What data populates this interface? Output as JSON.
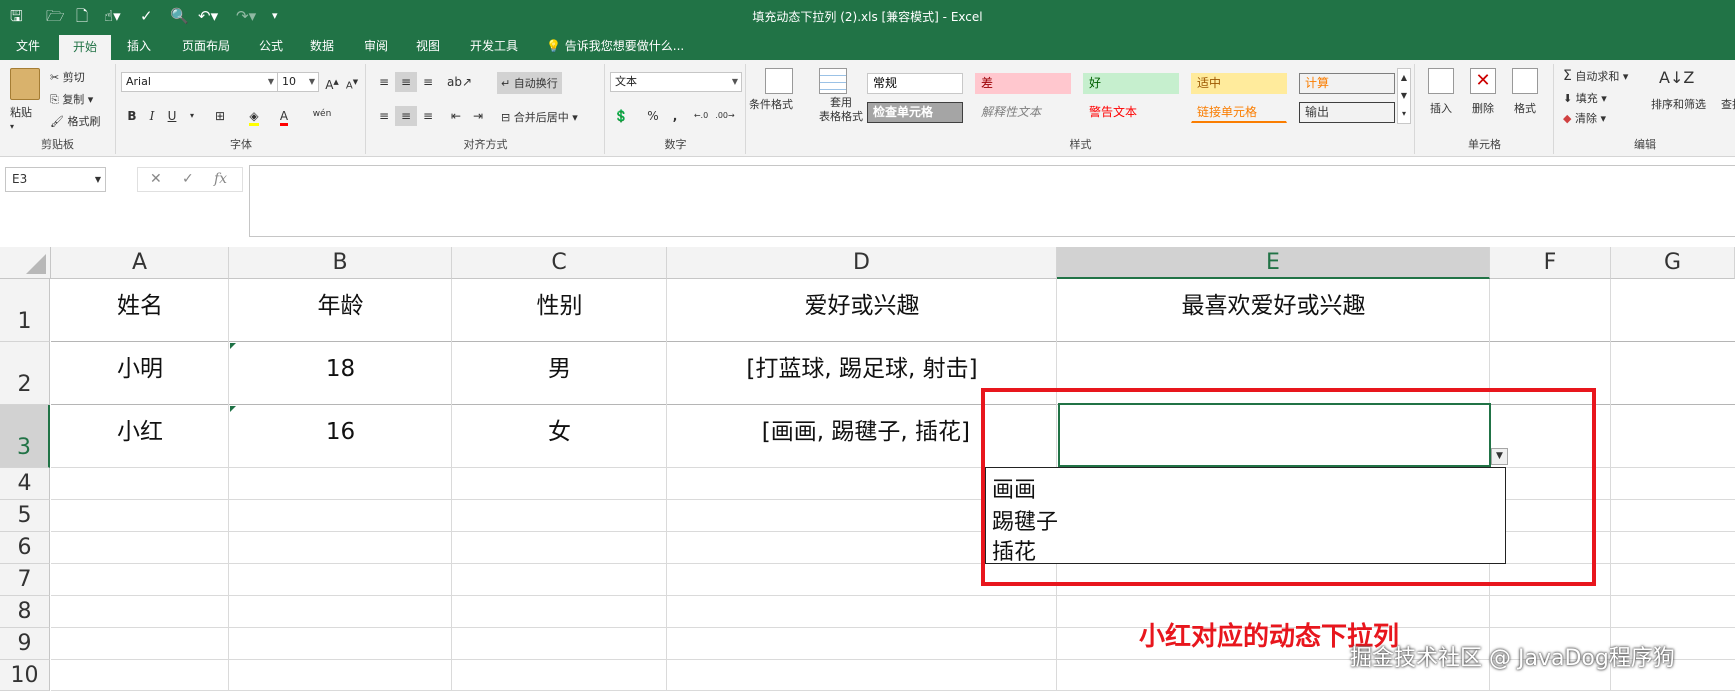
{
  "window": {
    "title": "填充动态下拉列 (2).xls  [兼容模式] - Excel",
    "accent_color": "#217346"
  },
  "quick_access": {
    "icons": [
      "save-icon",
      "open-icon",
      "new-icon",
      "touch-mode-icon",
      "spellcheck-icon",
      "print-preview-icon",
      "undo-icon",
      "redo-icon",
      "customize-icon"
    ]
  },
  "tabs": [
    "文件",
    "开始",
    "插入",
    "页面布局",
    "公式",
    "数据",
    "审阅",
    "视图",
    "开发工具"
  ],
  "active_tab": "开始",
  "tell_me": "告诉我您想要做什么...",
  "ribbon": {
    "clipboard": {
      "label": "剪贴板",
      "paste": "粘贴",
      "cut": "剪切",
      "copy": "复制",
      "format_painter": "格式刷"
    },
    "font": {
      "label": "字体",
      "name": "Arial",
      "size": "10",
      "bold": "B",
      "italic": "I",
      "underline": "U",
      "phonetic": "wén"
    },
    "alignment": {
      "label": "对齐方式",
      "wrap": "自动换行",
      "merge": "合并后居中"
    },
    "number": {
      "label": "数字",
      "format": "文本",
      "percent": "%",
      "comma": ","
    },
    "styles": {
      "label": "样式",
      "conditional": "条件格式",
      "table": "套用\n表格格式",
      "items": [
        {
          "text": "常规",
          "bg": "#ffffff",
          "fg": "#000000",
          "border": "#c8c8c8"
        },
        {
          "text": "差",
          "bg": "#ffc7ce",
          "fg": "#9c0006",
          "border": "#ffc7ce"
        },
        {
          "text": "好",
          "bg": "#c6efce",
          "fg": "#006100",
          "border": "#c6efce"
        },
        {
          "text": "适中",
          "bg": "#ffeb9c",
          "fg": "#9c5700",
          "border": "#ffeb9c"
        },
        {
          "text": "计算",
          "bg": "#f2f2f2",
          "fg": "#fa7d00",
          "border": "#7f7f7f"
        },
        {
          "text": "检查单元格",
          "bg": "#a5a5a5",
          "fg": "#ffffff",
          "border": "#3f3f3f"
        },
        {
          "text": "解释性文本",
          "bg": "#f3f3f3",
          "fg": "#7f7f7f",
          "border": "#f3f3f3"
        },
        {
          "text": "警告文本",
          "bg": "#f3f3f3",
          "fg": "#ff0000",
          "border": "#f3f3f3"
        },
        {
          "text": "链接单元格",
          "bg": "#f3f3f3",
          "fg": "#fa7d00",
          "border": "#f3f3f3"
        },
        {
          "text": "输出",
          "bg": "#f2f2f2",
          "fg": "#3f3f3f",
          "border": "#3f3f3f"
        }
      ]
    },
    "cells": {
      "label": "单元格",
      "insert": "插入",
      "delete": "删除",
      "format": "格式"
    },
    "editing": {
      "label": "编辑",
      "autosum": "自动求和",
      "fill": "填充",
      "clear": "清除",
      "sort": "排序和筛选",
      "find": "查找"
    }
  },
  "formula_bar": {
    "name_box": "E3",
    "cancel": "✕",
    "enter": "✓",
    "fx": "fx",
    "value": ""
  },
  "sheet": {
    "columns": [
      "A",
      "B",
      "C",
      "D",
      "E",
      "F",
      "G"
    ],
    "selected_column": "E",
    "rows": [
      "1",
      "2",
      "3",
      "4",
      "5",
      "6",
      "7",
      "8",
      "9",
      "10"
    ],
    "selected_row": "3",
    "cells": {
      "A1": "姓名",
      "B1": "年龄",
      "C1": "性别",
      "D1": "爱好或兴趣",
      "E1": "最喜欢爱好或兴趣",
      "A2": "小明",
      "B2": "18",
      "C2": "男",
      "D2": "[打蓝球, 踢足球, 射击]",
      "A3": "小红",
      "B3": "16",
      "C3": "女",
      "D3": "[画画, 踢毽子, 插花]",
      "E3": ""
    },
    "dropdown": {
      "options": [
        "画画",
        "踢毽子",
        "插花"
      ]
    }
  },
  "annotation": {
    "text": "小红对应的动态下拉列",
    "color": "#e8161d"
  },
  "watermark": "掘金技术社区 @ JavaDog程序狗"
}
